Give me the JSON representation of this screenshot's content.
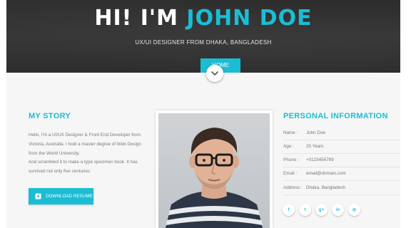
{
  "hero": {
    "greeting": "HI! I'M",
    "name": "JOHN DOE",
    "subtitle": "UX/UI DESIGNER FROM DHAKA, BANGLADESH",
    "home_button": "HOME"
  },
  "story": {
    "heading": "MY STORY",
    "paragraph_1": "Hello, I'm a UI/UX Designer & Front End Developer from Victoria, Australia. I hold a master degree of Web Design from the World University.",
    "paragraph_2": "And scrambled it to make a type specimen book. It has survived not only five centuries",
    "download_label": "DOWNLOAD RESUME"
  },
  "info": {
    "heading": "PERSONAL INFORMATION",
    "rows": [
      {
        "label": "Name :",
        "value": "John Doe"
      },
      {
        "label": "Age :",
        "value": "25 Years"
      },
      {
        "label": "Phone :",
        "value": "+0123456789"
      },
      {
        "label": "Email :",
        "value": "email@domain.com"
      },
      {
        "label": "Address :",
        "value": "Dhaka, Bangladesh"
      }
    ],
    "socials": [
      {
        "name": "facebook",
        "glyph": "f"
      },
      {
        "name": "twitter",
        "glyph": "t"
      },
      {
        "name": "google-plus",
        "glyph": "g+"
      },
      {
        "name": "linkedin",
        "glyph": "in"
      },
      {
        "name": "dribbble",
        "glyph": "◎"
      }
    ]
  },
  "colors": {
    "accent": "#1bbdd4",
    "background": "#f6f6f6",
    "hero_dark": "#3a3a3a"
  },
  "icons": {
    "scroll": "chevron-down-icon",
    "download": "download-icon"
  }
}
